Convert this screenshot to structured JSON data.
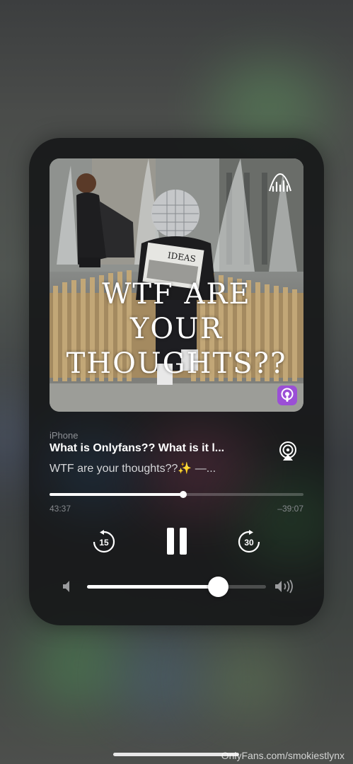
{
  "now_playing": {
    "device": "iPhone",
    "title": "What is Onlyfans?? What is it l...",
    "subtitle": "WTF are your thoughts??✨ —...",
    "progress_fraction": 0.527,
    "elapsed": "43:37",
    "remaining": "–39:07",
    "volume_fraction": 0.73
  },
  "artwork": {
    "title_lines": [
      "WTF ARE",
      "YOUR",
      "THOUGHTS??"
    ],
    "sign_text": "IDEAS"
  },
  "controls": {
    "skip_back_seconds": "15",
    "skip_forward_seconds": "30"
  },
  "icons": {
    "airplay": "airplay-icon",
    "skip_back": "skip-back-15-icon",
    "pause": "pause-icon",
    "skip_forward": "skip-forward-30-icon",
    "volume_low": "volume-low-icon",
    "volume_high": "volume-high-icon",
    "anchor": "anchor-podcast-logo-icon",
    "podcasts": "apple-podcasts-icon"
  },
  "watermark": "OnlyFans.com/smokiestlynx"
}
